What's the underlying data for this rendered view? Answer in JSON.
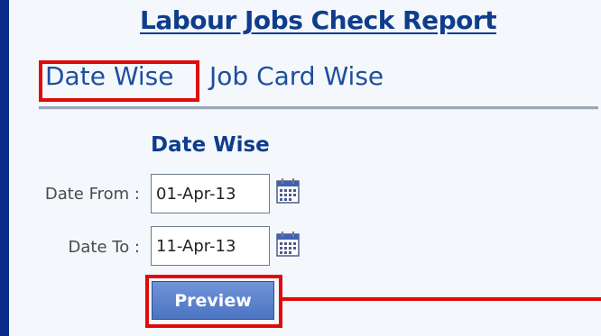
{
  "page": {
    "title": "Labour Jobs Check Report"
  },
  "tabs": [
    {
      "label": "Date Wise"
    },
    {
      "label": "Job Card Wise"
    }
  ],
  "section": {
    "title": "Date Wise"
  },
  "form": {
    "date_from": {
      "label": "Date From :",
      "value": "01-Apr-13"
    },
    "date_to": {
      "label": "Date To :",
      "value": "11-Apr-13"
    },
    "preview_label": "Preview"
  },
  "icons": {
    "date_from_picker": "calendar-icon",
    "date_to_picker": "calendar-icon"
  },
  "colors": {
    "frame": "#0a2a8c",
    "title": "#0f3d8c",
    "highlight": "#e10a0a",
    "button": "#5a80c9"
  }
}
